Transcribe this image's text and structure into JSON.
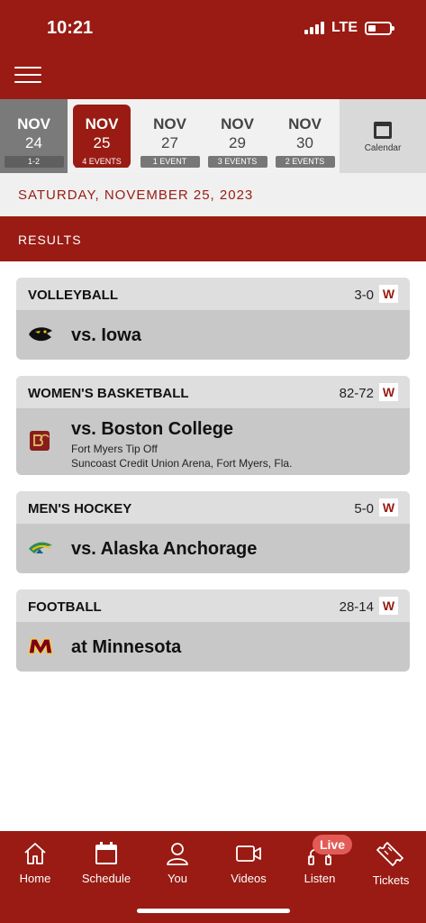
{
  "status_bar": {
    "time": "10:21",
    "network": "LTE"
  },
  "date_strip": [
    {
      "month": "NOV",
      "day": "24",
      "count": "1-2",
      "state": "past"
    },
    {
      "month": "NOV",
      "day": "25",
      "count": "4 EVENTS",
      "state": "selected"
    },
    {
      "month": "NOV",
      "day": "27",
      "count": "1 EVENT",
      "state": "upcoming"
    },
    {
      "month": "NOV",
      "day": "29",
      "count": "3 EVENTS",
      "state": "upcoming"
    },
    {
      "month": "NOV",
      "day": "30",
      "count": "2 EVENTS",
      "state": "upcoming"
    }
  ],
  "calendar_label": "Calendar",
  "selected_date": "SATURDAY, NOVEMBER 25, 2023",
  "results_label": "RESULTS",
  "games": [
    {
      "sport": "VOLLEYBALL",
      "score": "3-0",
      "result": "W",
      "opponent": "vs. Iowa",
      "logo": "iowa-hawkeye-logo"
    },
    {
      "sport": "WOMEN'S BASKETBALL",
      "score": "82-72",
      "result": "W",
      "opponent": "vs. Boston College",
      "event": "Fort Myers Tip Off",
      "venue": "Suncoast Credit Union Arena, Fort Myers, Fla.",
      "logo": "boston-college-logo"
    },
    {
      "sport": "MEN'S HOCKEY",
      "score": "5-0",
      "result": "W",
      "opponent": "vs. Alaska Anchorage",
      "logo": "alaska-anchorage-logo"
    },
    {
      "sport": "FOOTBALL",
      "score": "28-14",
      "result": "W",
      "opponent": "at Minnesota",
      "logo": "minnesota-logo"
    }
  ],
  "tabs": [
    {
      "label": "Home",
      "icon": "home-icon"
    },
    {
      "label": "Schedule",
      "icon": "calendar-icon"
    },
    {
      "label": "You",
      "icon": "person-icon"
    },
    {
      "label": "Videos",
      "icon": "video-camera-icon"
    },
    {
      "label": "Listen",
      "icon": "headphones-icon"
    },
    {
      "label": "Tickets",
      "icon": "ticket-icon"
    }
  ],
  "live_badge": "Live",
  "colors": {
    "brand": "#991b13",
    "card": "#c8c8c8",
    "card_header": "#dedede",
    "live": "#e25b56"
  }
}
